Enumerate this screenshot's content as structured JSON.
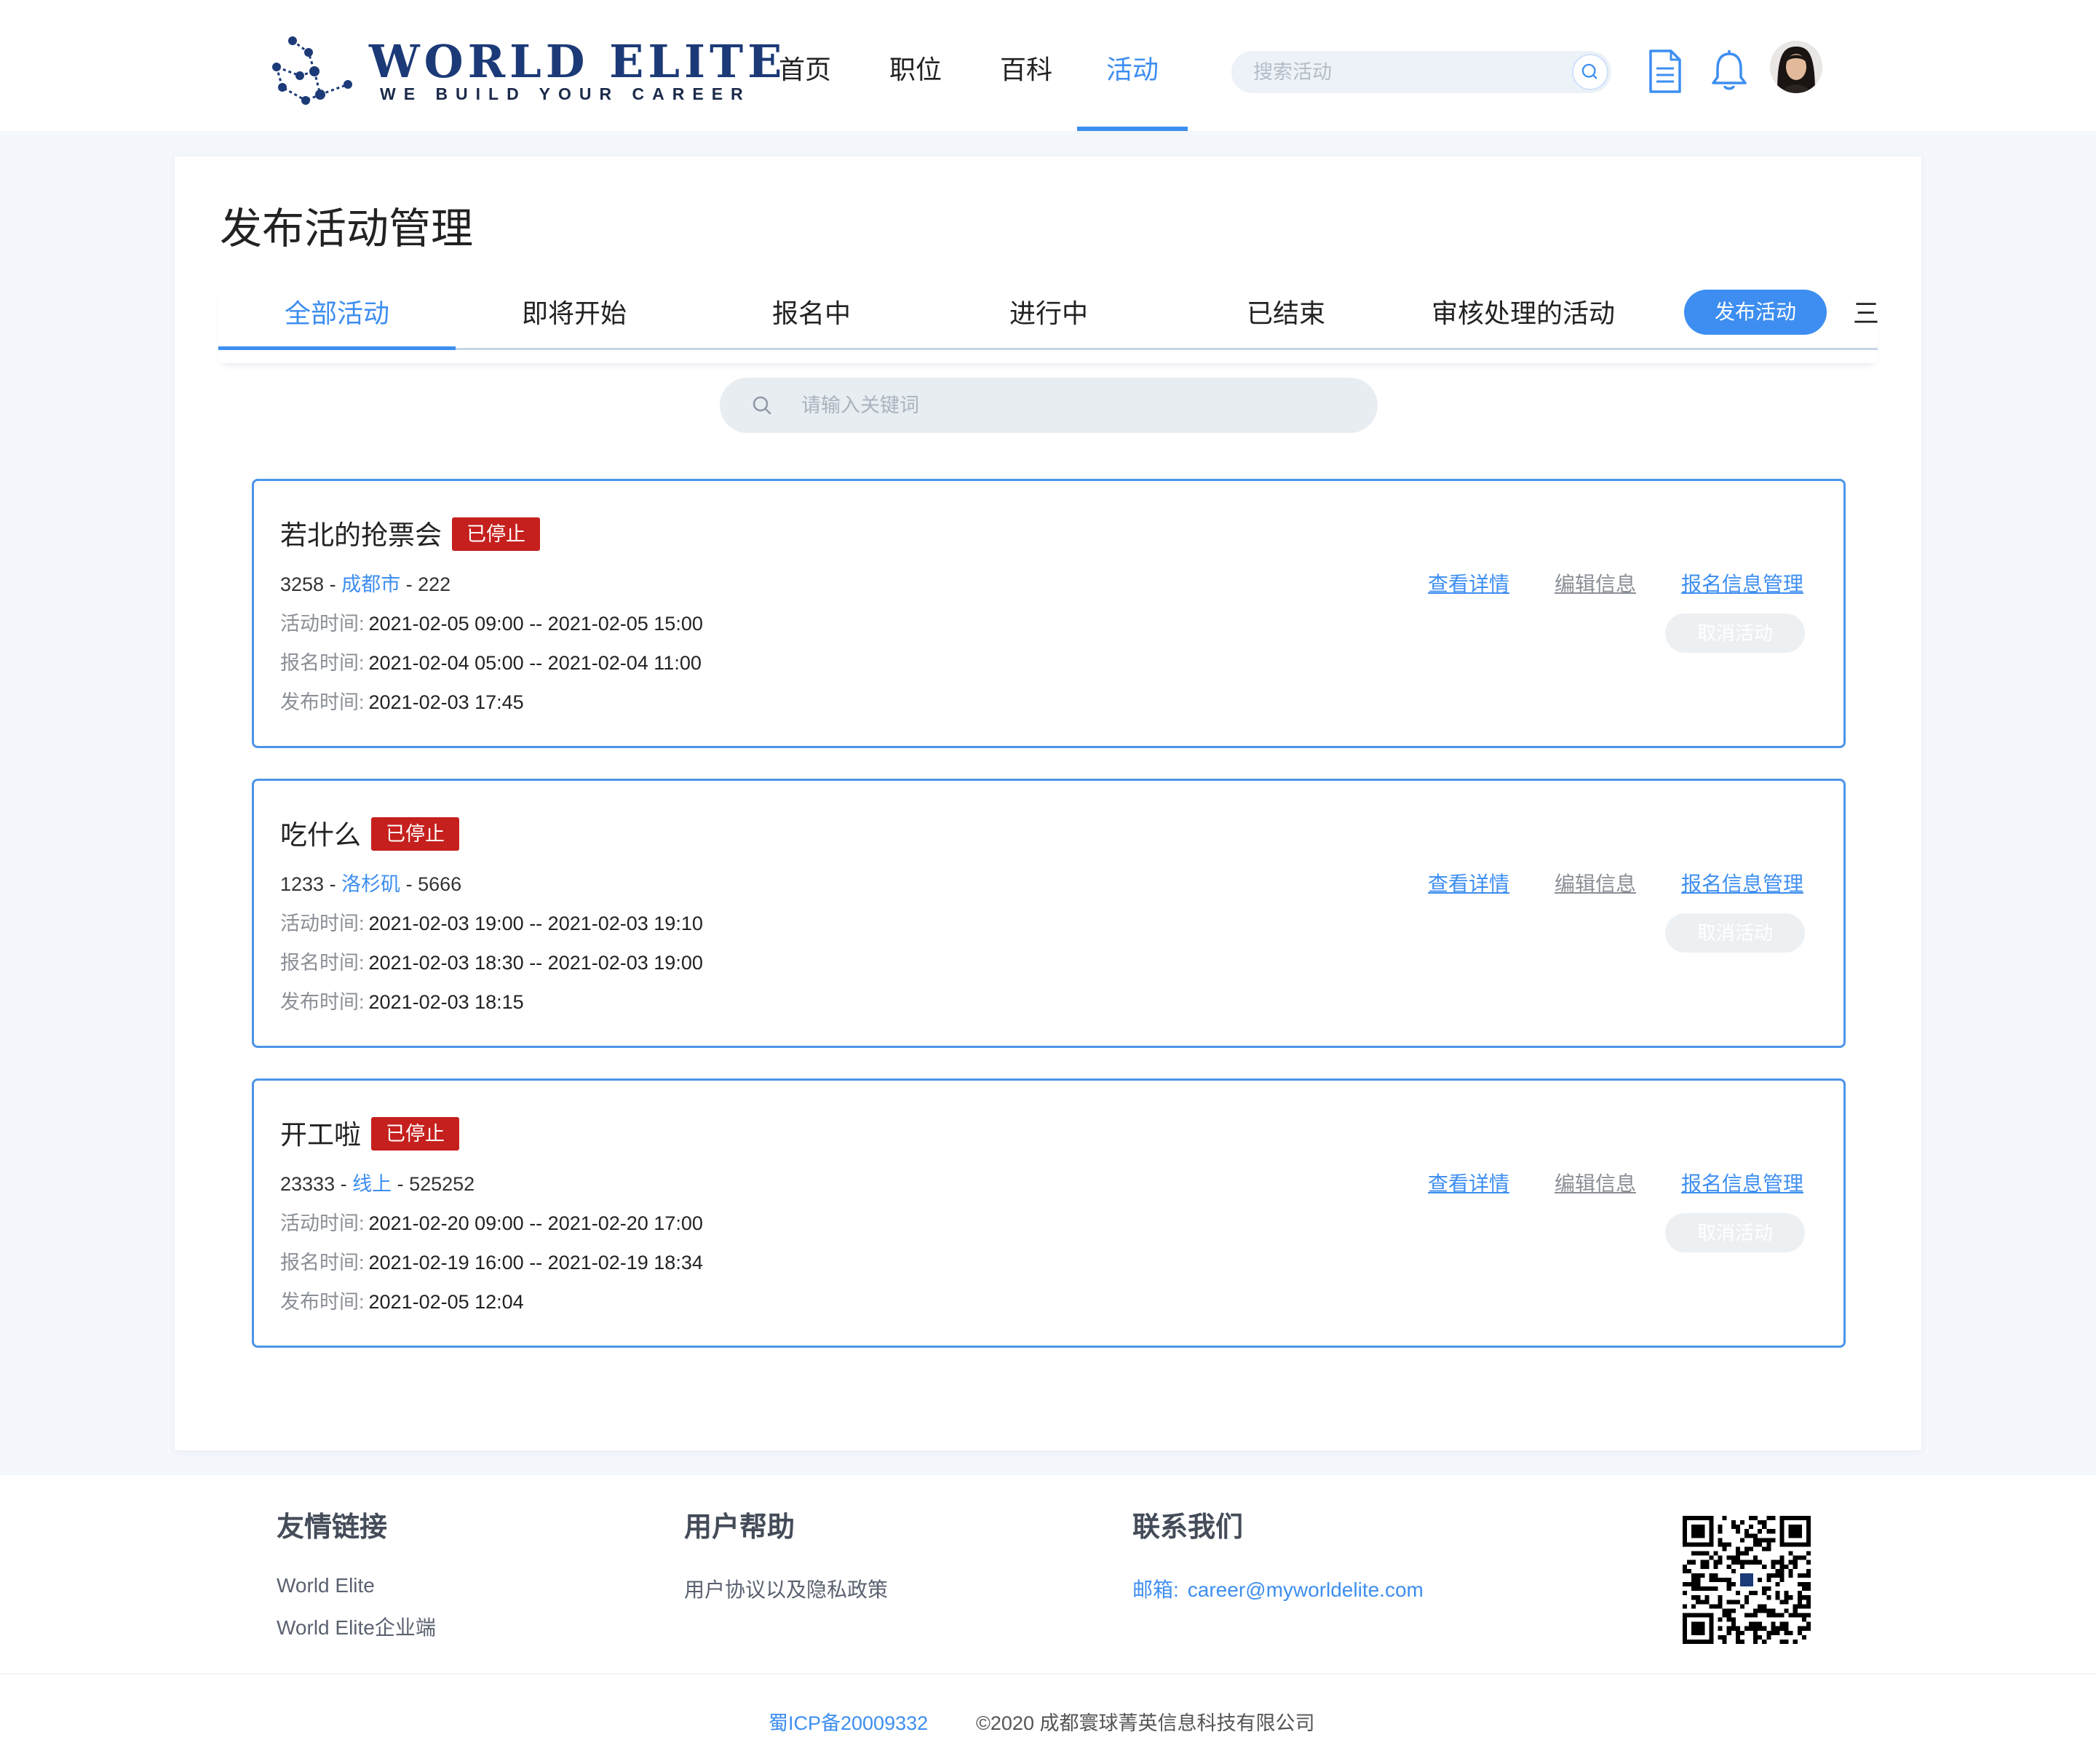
{
  "header": {
    "logo_title": "WORLD ELITE",
    "logo_subtitle": "WE BUILD YOUR CAREER",
    "nav": [
      {
        "label": "首页",
        "active": false
      },
      {
        "label": "职位",
        "active": false
      },
      {
        "label": "百科",
        "active": false
      },
      {
        "label": "活动",
        "active": true
      }
    ],
    "search_placeholder": "搜索活动",
    "icons": [
      "search-icon",
      "document-icon",
      "bell-icon",
      "avatar"
    ]
  },
  "page": {
    "title": "发布活动管理",
    "tabs": [
      {
        "label": "全部活动",
        "active": true
      },
      {
        "label": "即将开始",
        "active": false
      },
      {
        "label": "报名中",
        "active": false
      },
      {
        "label": "进行中",
        "active": false
      },
      {
        "label": "已结束",
        "active": false
      },
      {
        "label": "审核处理的活动",
        "active": false
      }
    ],
    "publish_button": "发布活动",
    "more_tab": "三l",
    "keyword_placeholder": "请输入关键词"
  },
  "labels": {
    "activity_time": "活动时间:",
    "signup_time": "报名时间:",
    "publish_time": "发布时间:",
    "view_detail": "查看详情",
    "edit_info": "编辑信息",
    "signup_manage": "报名信息管理",
    "cancel_activity": "取消活动"
  },
  "events": [
    {
      "title": "若北的抢票会",
      "status": "已停止",
      "code": "3258",
      "city": "成都市",
      "venue": "222",
      "activity_time": "2021-02-05 09:00 -- 2021-02-05 15:00",
      "signup_time": "2021-02-04 05:00 -- 2021-02-04 11:00",
      "publish_time": "2021-02-03 17:45"
    },
    {
      "title": "吃什么",
      "status": "已停止",
      "code": "1233",
      "city": "洛杉矶",
      "venue": "5666",
      "activity_time": "2021-02-03 19:00 -- 2021-02-03 19:10",
      "signup_time": "2021-02-03 18:30 -- 2021-02-03 19:00",
      "publish_time": "2021-02-03 18:15"
    },
    {
      "title": "开工啦",
      "status": "已停止",
      "code": "23333",
      "city": "线上",
      "venue": "525252",
      "activity_time": "2021-02-20 09:00 -- 2021-02-20 17:00",
      "signup_time": "2021-02-19 16:00 -- 2021-02-19 18:34",
      "publish_time": "2021-02-05 12:04"
    }
  ],
  "footer": {
    "friend_links_title": "友情链接",
    "friend_links": [
      "World Elite",
      "World Elite企业端"
    ],
    "help_title": "用户帮助",
    "help_links": [
      "用户协议以及隐私政策"
    ],
    "contact_title": "联系我们",
    "email_label": "邮箱:",
    "email": "career@myworldelite.com",
    "icp": "蜀ICP备20009332",
    "copyright": "©2020 成都寰球菁英信息科技有限公司"
  },
  "colors": {
    "accent": "#3d8ef0",
    "badge_red": "#c5201d",
    "logo_navy": "#1c3a77"
  }
}
